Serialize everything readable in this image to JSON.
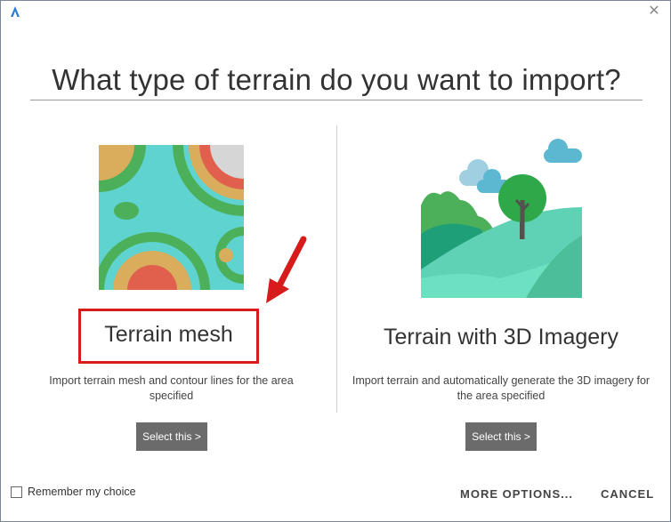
{
  "window": {
    "app_icon": "autodesk-a-icon",
    "close_icon": "close-icon"
  },
  "dialog": {
    "title": "What type of terrain do you want to import?"
  },
  "options": [
    {
      "title": "Terrain mesh",
      "description": "Import terrain mesh and contour lines for the area specified",
      "button": "Select this >",
      "image_icon": "terrain-mesh-illustration"
    },
    {
      "title": "Terrain with 3D Imagery",
      "description": "Import terrain and automatically generate the 3D imagery for the area specified",
      "button": "Select this >",
      "image_icon": "landscape-illustration"
    }
  ],
  "footer": {
    "remember_label": "Remember my choice",
    "remember_checked": false,
    "more_options": "MORE OPTIONS...",
    "cancel": "CANCEL"
  },
  "colors": {
    "highlight": "#d71a1a",
    "button_bg": "#6b6b6b"
  }
}
